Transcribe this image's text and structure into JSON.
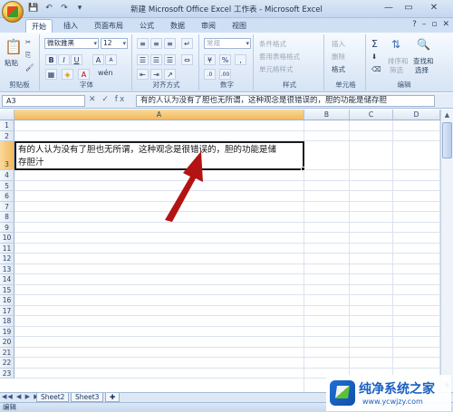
{
  "window": {
    "title": "新建 Microsoft Office Excel 工作表 - Microsoft Excel"
  },
  "tabs": [
    "开始",
    "插入",
    "页面布局",
    "公式",
    "数据",
    "审阅",
    "视图"
  ],
  "ribbon": {
    "clipboard": {
      "paste": "粘贴",
      "label": "剪贴板"
    },
    "font": {
      "name": "微软雅黑",
      "size": "12",
      "bold": "B",
      "italic": "I",
      "underline": "U",
      "grow": "A",
      "shrink": "A",
      "font_color": "A",
      "wen": "wén",
      "label": "字体"
    },
    "alignment": {
      "label": "对齐方式"
    },
    "number": {
      "format": "常规",
      "percent": "%",
      "comma": ",",
      "label": "数字"
    },
    "styles": {
      "conditional": "条件格式",
      "table": "套用表格格式",
      "cell": "单元格样式",
      "label": "样式"
    },
    "cells": {
      "insert": "插入",
      "delete": "删除",
      "format": "格式",
      "label": "单元格"
    },
    "editing": {
      "sigma": "Σ",
      "sort": "排序和",
      "sort2": "筛选",
      "find": "查找和",
      "find2": "选择",
      "label": "编辑"
    }
  },
  "formula_bar": {
    "name_box": "A3",
    "icons": "✕ ✓ fx",
    "content": "有的人认为没有了胆也无所谓，这种观念是很错误的，胆的功能是储存胆"
  },
  "columns": [
    "A",
    "B",
    "C",
    "D"
  ],
  "rows": [
    "1",
    "2",
    "3",
    "4",
    "5",
    "6",
    "7",
    "8",
    "9",
    "10",
    "11",
    "12",
    "13",
    "14",
    "15",
    "16",
    "17",
    "18",
    "19",
    "20",
    "21",
    "22",
    "23"
  ],
  "cell_a3": {
    "line1": "有的人认为没有了胆也无所谓，这种观念是很错误的，胆的功能是储",
    "line2": "存胆汁"
  },
  "sheets": [
    "Sheet2",
    "Sheet3"
  ],
  "status": "编辑",
  "watermark": {
    "title": "纯净系统之家",
    "url": "www.ycwjzy.com"
  }
}
